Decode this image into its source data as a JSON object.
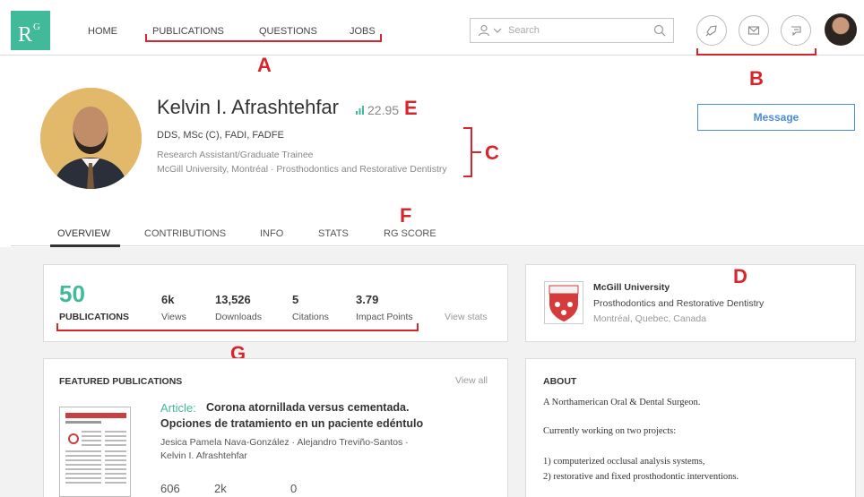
{
  "nav": {
    "logo": "R",
    "logo_sup": "G",
    "links": [
      "HOME",
      "PUBLICATIONS",
      "QUESTIONS",
      "JOBS"
    ],
    "search_placeholder": "Search"
  },
  "annotations": {
    "a": "A",
    "b": "B",
    "c": "C",
    "d": "D",
    "e": "E",
    "f": "F",
    "g": "G"
  },
  "profile": {
    "name": "Kelvin I. Afrashtehfar",
    "rg_score": "22.95",
    "degrees": "DDS, MSc (C), FADI, FADFE",
    "position": "Research Assistant/Graduate Trainee",
    "affiliation": "McGill University, Montréal · Prosthodontics and Restorative Dentistry",
    "message_button": "Message"
  },
  "tabs": [
    "OVERVIEW",
    "CONTRIBUTIONS",
    "INFO",
    "STATS",
    "RG SCORE"
  ],
  "stats": {
    "publications_count": "50",
    "publications_label": "PUBLICATIONS",
    "items": [
      {
        "value": "6k",
        "label": "Views"
      },
      {
        "value": "13,526",
        "label": "Downloads"
      },
      {
        "value": "5",
        "label": "Citations"
      },
      {
        "value": "3.79",
        "label": "Impact Points"
      }
    ],
    "view_stats": "View stats"
  },
  "institution": {
    "name": "McGill University",
    "department": "Prosthodontics and Restorative Dentistry",
    "location": "Montréal, Quebec, Canada"
  },
  "featured": {
    "title": "FEATURED PUBLICATIONS",
    "view_all": "View all",
    "type": "Article:",
    "pub_title_1": "Corona atornillada versus cementada.",
    "pub_title_2": "Opciones de tratamiento en un paciente edéntulo",
    "authors_1": "Jesica Pamela Nava-González · Alejandro Treviño-Santos ·",
    "authors_2": "Kelvin I. Afrashtehfar",
    "numbers": [
      "606",
      "2k",
      "0"
    ]
  },
  "about": {
    "title": "ABOUT",
    "line1": "A Northamerican Oral & Dental Surgeon.",
    "line2": "Currently working on two projects:",
    "line3": "1) computerized occlusal analysis systems,",
    "line4": "2) restorative and fixed prosthodontic interventions."
  },
  "colors": {
    "brand": "#40ba9b",
    "accent_blue": "#4a8cd6",
    "annotation_red": "#d6262b"
  }
}
